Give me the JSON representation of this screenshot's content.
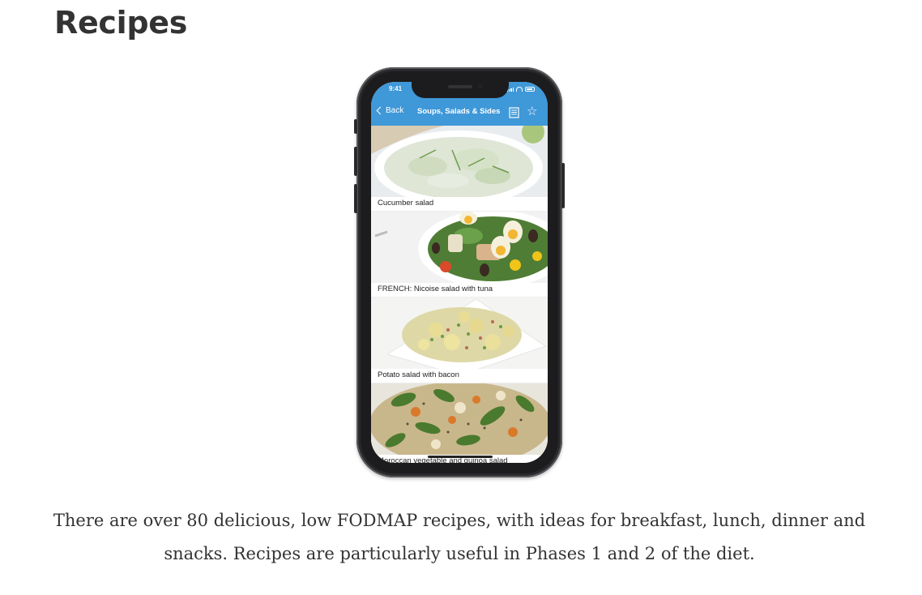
{
  "page": {
    "title": "Recipes"
  },
  "phone": {
    "status_bar": {
      "time": "9:41"
    },
    "nav_bar": {
      "back_label": "Back",
      "title": "Soups, Salads & Sides",
      "doc_icon": "document-icon",
      "star_icon": "star-icon"
    },
    "recipes": [
      {
        "name": "Cucumber salad"
      },
      {
        "name": "FRENCH: Nicoise salad with tuna"
      },
      {
        "name": "Potato salad with bacon"
      },
      {
        "name": "Moroccan vegetable and quinoa salad"
      }
    ]
  },
  "description": "There are over 80 delicious, low FODMAP recipes, with ideas for breakfast, lunch, dinner and snacks. Recipes are particularly useful in Phases 1 and 2 of the diet."
}
